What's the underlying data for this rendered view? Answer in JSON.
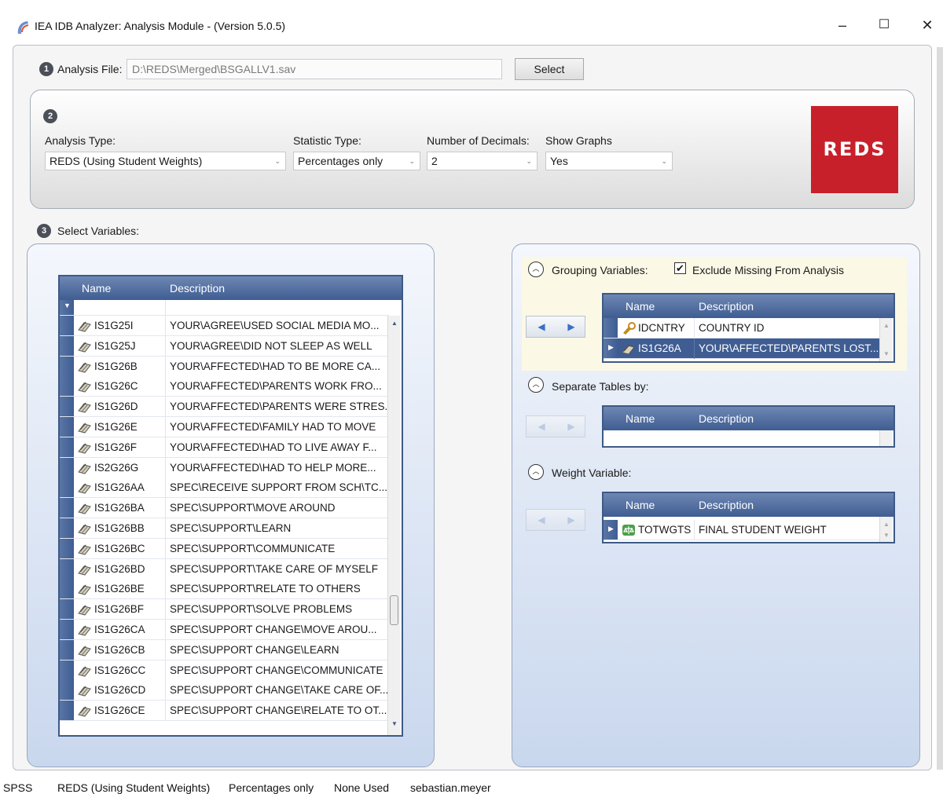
{
  "window": {
    "title": "IEA IDB Analyzer: Analysis Module - (Version 5.0.5)",
    "controls": {
      "minimize": "–",
      "maximize": "☐",
      "close": "✕"
    }
  },
  "step1": {
    "number": "1",
    "label": "Analysis File:",
    "file_path": "D:\\REDS\\Merged\\BSGALLV1.sav",
    "select_label": "Select"
  },
  "step2": {
    "number": "2",
    "analysis_type": {
      "label": "Analysis Type:",
      "value": "REDS (Using Student Weights)"
    },
    "statistic_type": {
      "label": "Statistic Type:",
      "value": "Percentages only"
    },
    "decimals": {
      "label": "Number of Decimals:",
      "value": "2"
    },
    "show_graphs": {
      "label": "Show Graphs",
      "value": "Yes"
    },
    "logo_text": "REDS"
  },
  "step3": {
    "number": "3",
    "label": "Select Variables:"
  },
  "variables_grid": {
    "col_name": "Name",
    "col_desc": "Description",
    "filter_glyph": "▼",
    "rows": [
      {
        "name": "IS1G25I",
        "desc": "YOUR\\AGREE\\USED SOCIAL MEDIA MO..."
      },
      {
        "name": "IS1G25J",
        "desc": "YOUR\\AGREE\\DID NOT SLEEP AS WELL"
      },
      {
        "name": "IS1G26B",
        "desc": "YOUR\\AFFECTED\\HAD TO BE MORE CA..."
      },
      {
        "name": "IS1G26C",
        "desc": "YOUR\\AFFECTED\\PARENTS WORK FRO..."
      },
      {
        "name": "IS1G26D",
        "desc": "YOUR\\AFFECTED\\PARENTS WERE STRES..."
      },
      {
        "name": "IS1G26E",
        "desc": "YOUR\\AFFECTED\\FAMILY HAD TO MOVE"
      },
      {
        "name": "IS1G26F",
        "desc": "YOUR\\AFFECTED\\HAD TO LIVE AWAY F..."
      },
      {
        "name": "IS2G26G",
        "desc": "YOUR\\AFFECTED\\HAD TO HELP MORE..."
      },
      {
        "name": "IS1G26AA",
        "desc": "SPEC\\RECEIVE SUPPORT FROM SCH\\TC..."
      },
      {
        "name": "IS1G26BA",
        "desc": "SPEC\\SUPPORT\\MOVE AROUND"
      },
      {
        "name": "IS1G26BB",
        "desc": "SPEC\\SUPPORT\\LEARN"
      },
      {
        "name": "IS1G26BC",
        "desc": "SPEC\\SUPPORT\\COMMUNICATE"
      },
      {
        "name": "IS1G26BD",
        "desc": "SPEC\\SUPPORT\\TAKE CARE OF MYSELF"
      },
      {
        "name": "IS1G26BE",
        "desc": "SPEC\\SUPPORT\\RELATE TO OTHERS"
      },
      {
        "name": "IS1G26BF",
        "desc": "SPEC\\SUPPORT\\SOLVE PROBLEMS"
      },
      {
        "name": "IS1G26CA",
        "desc": "SPEC\\SUPPORT CHANGE\\MOVE AROU..."
      },
      {
        "name": "IS1G26CB",
        "desc": "SPEC\\SUPPORT CHANGE\\LEARN"
      },
      {
        "name": "IS1G26CC",
        "desc": "SPEC\\SUPPORT CHANGE\\COMMUNICATE"
      },
      {
        "name": "IS1G26CD",
        "desc": "SPEC\\SUPPORT CHANGE\\TAKE CARE OF..."
      },
      {
        "name": "IS1G26CE",
        "desc": "SPEC\\SUPPORT CHANGE\\RELATE TO OT..."
      }
    ]
  },
  "grouping": {
    "header": "Grouping Variables:",
    "exclude_missing_label": "Exclude Missing From Analysis",
    "exclude_missing_checked": true,
    "col_name": "Name",
    "col_desc": "Description",
    "rows": [
      {
        "name": "IDCNTRY",
        "desc": "COUNTRY ID"
      },
      {
        "name": "IS1G26A",
        "desc": "YOUR\\AFFECTED\\PARENTS LOST..."
      }
    ]
  },
  "separate": {
    "header": "Separate Tables by:",
    "col_name": "Name",
    "col_desc": "Description"
  },
  "weight": {
    "header": "Weight Variable:",
    "col_name": "Name",
    "col_desc": "Description",
    "rows": [
      {
        "name": "TOTWGTS",
        "desc": "FINAL STUDENT WEIGHT"
      }
    ]
  },
  "statusbar": {
    "software": "SPSS",
    "analysis": "REDS (Using Student Weights)",
    "statistic": "Percentages only",
    "none_used": "None Used",
    "user": "sebastian.meyer"
  },
  "colors": {
    "grid_header": "#3f5d92",
    "selected_row": "#3f5d92",
    "logo_bg": "#c8202a"
  }
}
